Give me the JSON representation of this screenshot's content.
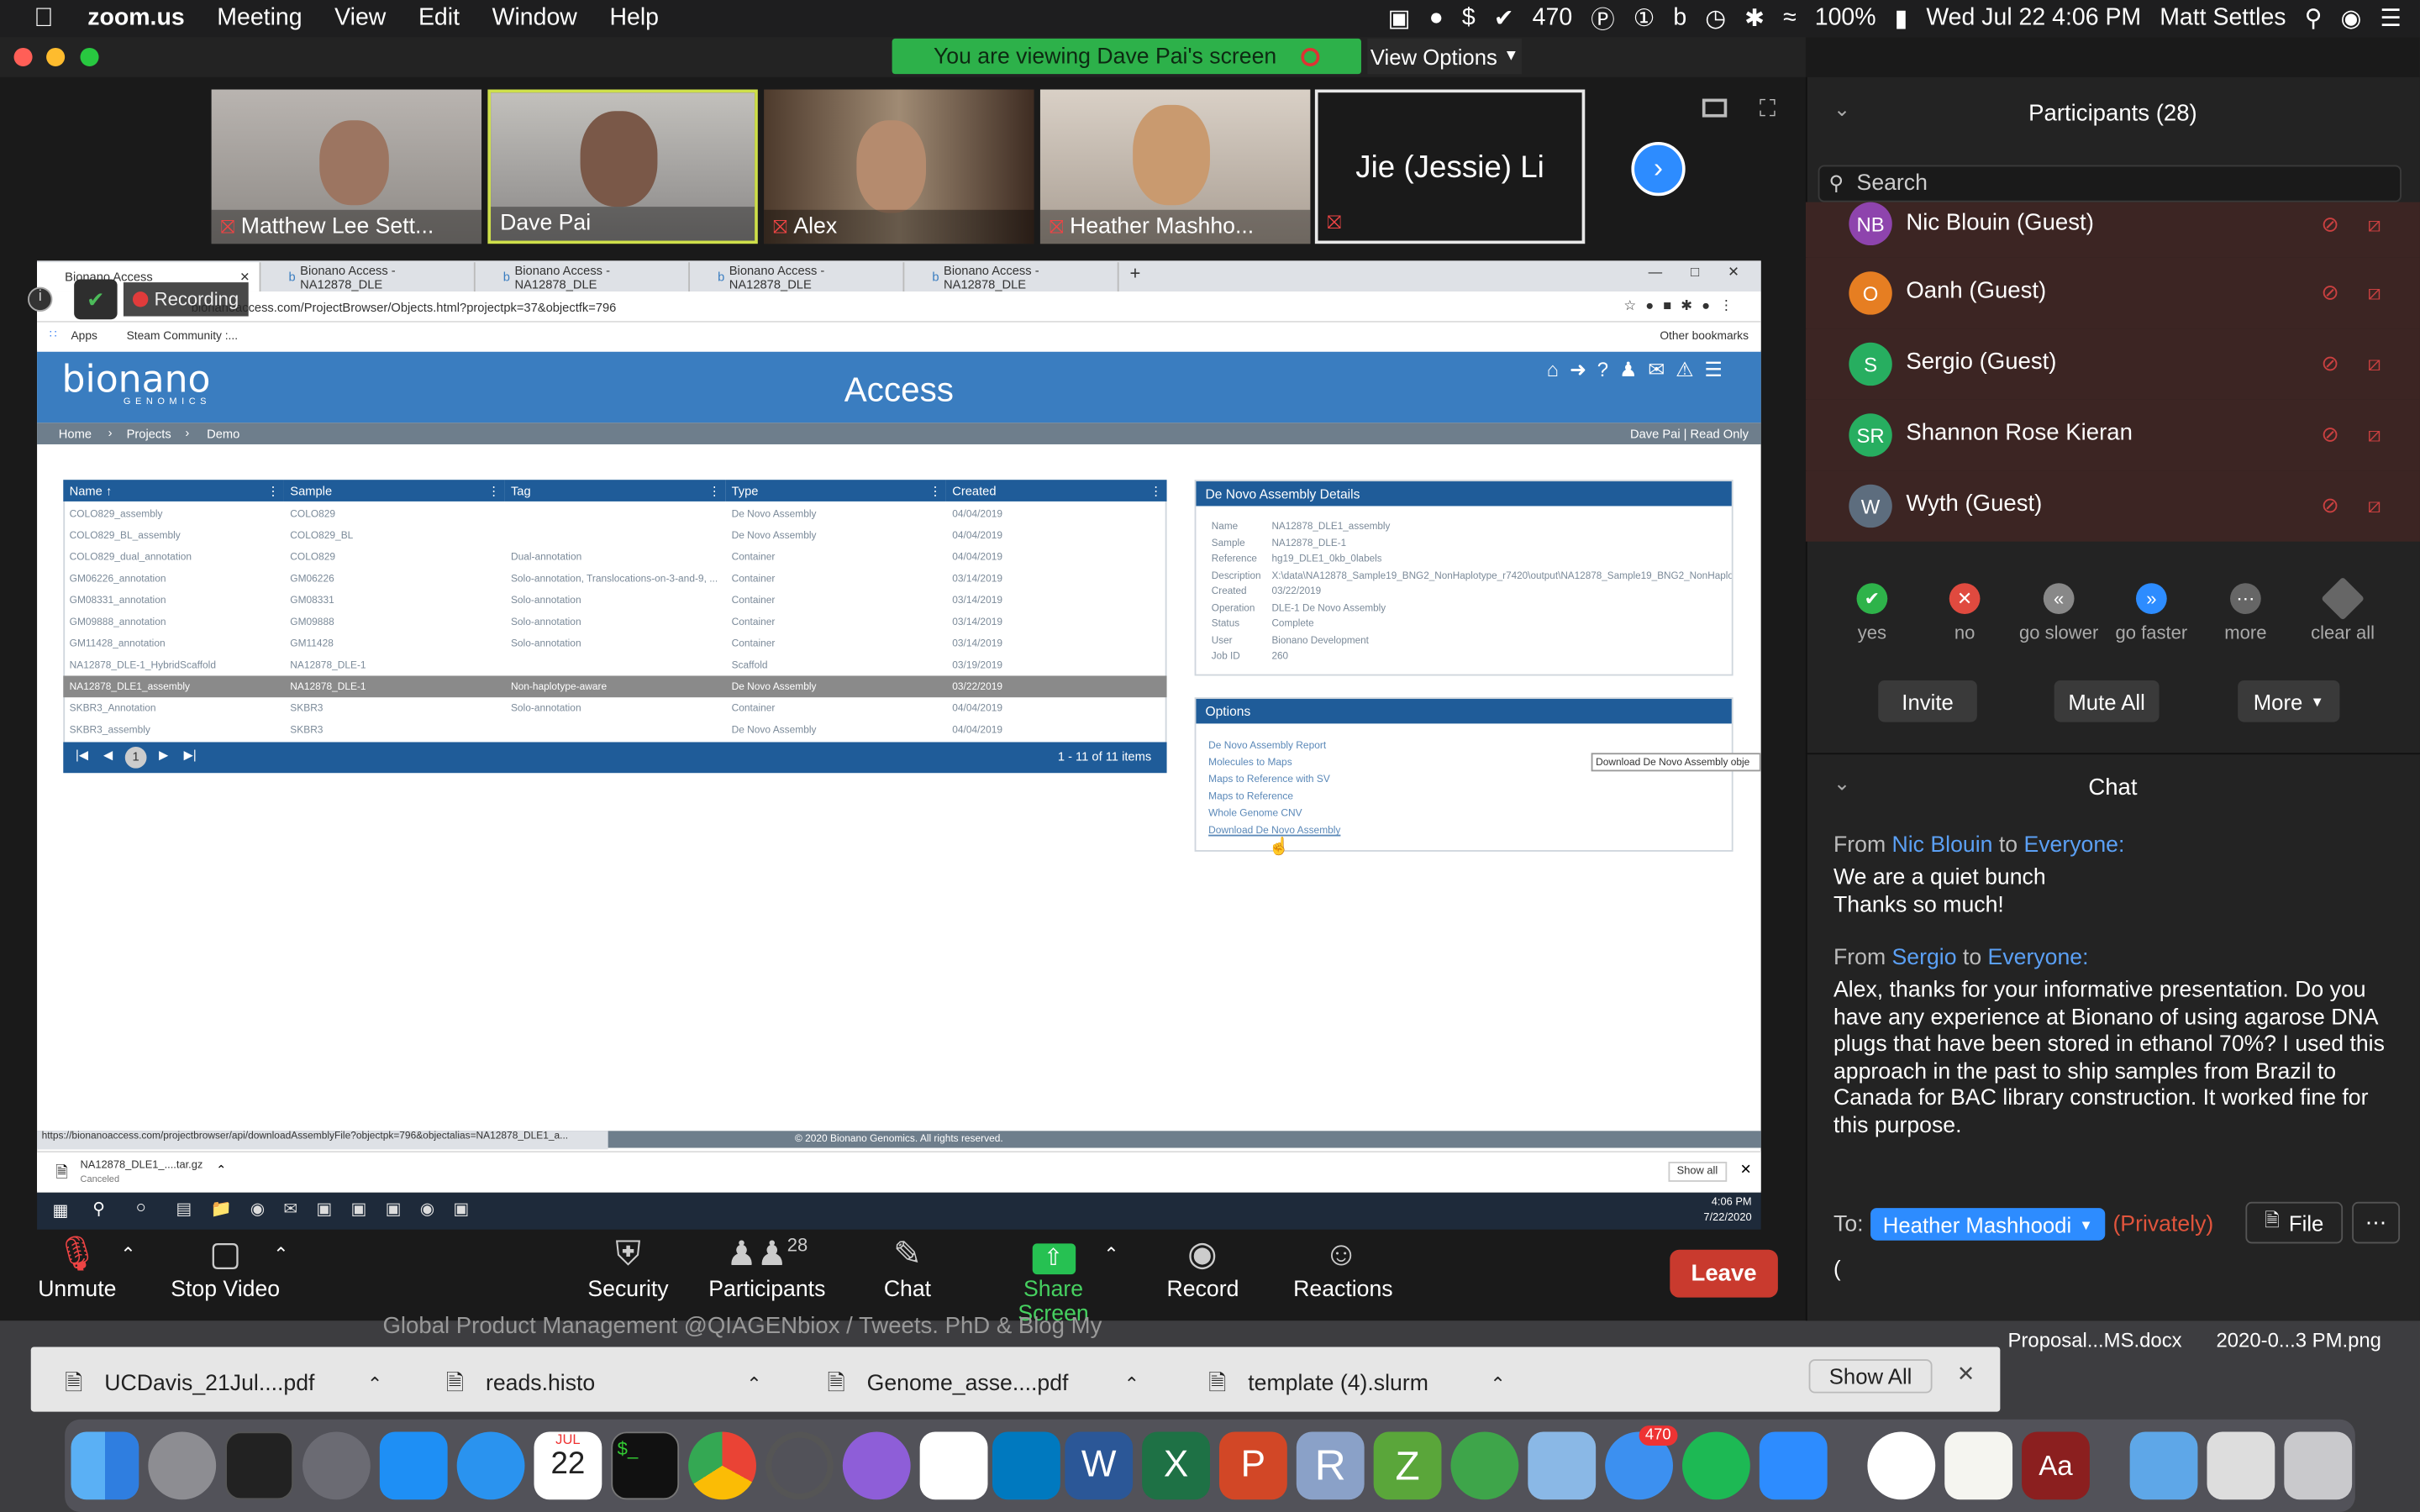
{
  "menubar": {
    "app": "zoom.us",
    "items": [
      "Meeting",
      "View",
      "Edit",
      "Window",
      "Help"
    ],
    "status": {
      "count": "470",
      "battery": "100%",
      "datetime": "Wed Jul 22  4:06 PM",
      "user": "Matt Settles"
    }
  },
  "banner": {
    "viewing": "You are viewing Dave Pai's screen",
    "view_options": "View Options"
  },
  "video_tiles": [
    {
      "name": "Matthew Lee Sett..."
    },
    {
      "name": "Dave Pai"
    },
    {
      "name": "Alex"
    },
    {
      "name": "Heather Mashho..."
    },
    {
      "name": "Jie (Jessie) Li"
    }
  ],
  "browser": {
    "tabs": [
      "Bionano Access",
      "Bionano Access - NA12878_DLE",
      "Bionano Access - NA12878_DLE",
      "Bionano Access - NA12878_DLE",
      "Bionano Access - NA12878_DLE"
    ],
    "recording": "Recording",
    "url": "bionanoaccess.com/ProjectBrowser/Objects.html?projectpk=37&objectfk=796",
    "bookmarks": [
      "Apps",
      "Steam Community :...",
      "Other bookmarks"
    ],
    "logo": "bionano",
    "logo_sub": "GENOMICS",
    "header_title": "Access",
    "breadcrumb": [
      "Home",
      "Projects",
      "Demo"
    ],
    "user_info": "Dave Pai | Read Only",
    "grid": {
      "columns": [
        "Name ↑",
        "Sample",
        "Tag",
        "Type",
        "Created"
      ],
      "rows": [
        [
          "COLO829_assembly",
          "COLO829",
          "",
          "De Novo Assembly",
          "04/04/2019"
        ],
        [
          "COLO829_BL_assembly",
          "COLO829_BL",
          "",
          "De Novo Assembly",
          "04/04/2019"
        ],
        [
          "COLO829_dual_annotation",
          "COLO829",
          "Dual-annotation",
          "Container",
          "04/04/2019"
        ],
        [
          "GM06226_annotation",
          "GM06226",
          "Solo-annotation, Translocations-on-3-and-9, ...",
          "Container",
          "03/14/2019"
        ],
        [
          "GM08331_annotation",
          "GM08331",
          "Solo-annotation",
          "Container",
          "03/14/2019"
        ],
        [
          "GM09888_annotation",
          "GM09888",
          "Solo-annotation",
          "Container",
          "03/14/2019"
        ],
        [
          "GM11428_annotation",
          "GM11428",
          "Solo-annotation",
          "Container",
          "03/14/2019"
        ],
        [
          "NA12878_DLE-1_HybridScaffold",
          "NA12878_DLE-1",
          "",
          "Scaffold",
          "03/19/2019"
        ],
        [
          "NA12878_DLE1_assembly",
          "NA12878_DLE-1",
          "Non-haplotype-aware",
          "De Novo Assembly",
          "03/22/2019"
        ],
        [
          "SKBR3_Annotation",
          "SKBR3",
          "Solo-annotation",
          "Container",
          "04/04/2019"
        ],
        [
          "SKBR3_assembly",
          "SKBR3",
          "",
          "De Novo Assembly",
          "04/04/2019"
        ]
      ],
      "page": "1",
      "items_text": "1 - 11 of 11 items"
    },
    "details": {
      "title": "De Novo Assembly Details",
      "fields": [
        [
          "Name",
          "NA12878_DLE1_assembly"
        ],
        [
          "Sample",
          "NA12878_DLE-1"
        ],
        [
          "Reference",
          "hg19_DLE1_0kb_0labels"
        ],
        [
          "Description",
          "X:\\data\\NA12878_Sample19_BNG2_NonHaplotype_r7420\\output\\NA12878_Sample19_BNG2_NonHaplo"
        ],
        [
          "Created",
          "03/22/2019"
        ],
        [
          "Operation",
          "DLE-1 De Novo Assembly"
        ],
        [
          "Status",
          "Complete"
        ],
        [
          "User",
          "Bionano Development"
        ],
        [
          "Job ID",
          "260"
        ]
      ]
    },
    "options": {
      "title": "Options",
      "items": [
        "De Novo Assembly Report",
        "Molecules to Maps",
        "Maps to Reference with SV",
        "Maps to Reference",
        "Whole Genome CNV",
        "Download De Novo Assembly"
      ],
      "tooltip": "Download De Novo Assembly obje"
    },
    "footer": "© 2020 Bionano Genomics. All rights reserved.",
    "status_url": "https://bionanoaccess.com/projectbrowser/api/downloadAssemblyFile?objectpk=796&objectalias=NA12878_DLE1_a...",
    "download": {
      "file": "NA12878_DLE1_....tar.gz",
      "state": "Canceled",
      "show_all": "Show all"
    },
    "win_clock": {
      "time": "4:06 PM",
      "date": "7/22/2020"
    }
  },
  "toolbar": {
    "unmute": "Unmute",
    "stop_video": "Stop Video",
    "security": "Security",
    "participants": "Participants",
    "participant_count": "28",
    "chat": "Chat",
    "share": "Share Screen",
    "record": "Record",
    "reactions": "Reactions",
    "leave": "Leave"
  },
  "participants_panel": {
    "title": "Participants (28)",
    "search_placeholder": "Search",
    "list": [
      {
        "initials": "NB",
        "name": "Nic Blouin (Guest)",
        "color": "#8e44ad"
      },
      {
        "initials": "O",
        "name": "Oanh (Guest)",
        "color": "#e67e22"
      },
      {
        "initials": "S",
        "name": "Sergio (Guest)",
        "color": "#27ae60"
      },
      {
        "initials": "SR",
        "name": "Shannon Rose Kieran",
        "color": "#27ae60"
      },
      {
        "initials": "W",
        "name": "Wyth (Guest)",
        "color": "#5d6d7e"
      }
    ],
    "feedback": [
      "yes",
      "no",
      "go slower",
      "go faster",
      "more",
      "clear all"
    ],
    "invite": "Invite",
    "mute_all": "Mute All",
    "more": "More"
  },
  "chat_panel": {
    "title": "Chat",
    "messages": [
      {
        "from": "Nic Blouin",
        "to": "Everyone:",
        "lines": [
          "We are a quiet bunch",
          "Thanks so much!"
        ]
      },
      {
        "from": "Sergio",
        "to": "Everyone:",
        "text": "Alex, thanks for your informative presentation. Do you have any experience at Bionano of using agarose DNA plugs that have been stored in ethanol 70%? I used this approach in the past to ship samples from Brazil to Canada for BAC library construction. It worked fine for this purpose."
      }
    ],
    "to_label": "To:",
    "recipient": "Heather Mashhoodi",
    "privately": "(Privately)",
    "file": "File",
    "input": "("
  },
  "behind": {
    "tweet_text": "Global Product Management @QIAGENbiox  / Tweets. PhD & Blog My",
    "desktop_files": [
      "Proposal...MS.docx",
      "2020-0...3 PM.png"
    ]
  },
  "mac_downloads": {
    "items": [
      "UCDavis_21Jul....pdf",
      "reads.histo",
      "Genome_asse....pdf",
      "template (4).slurm"
    ],
    "show_all": "Show All"
  },
  "dock": {
    "calendar_month": "JUL",
    "calendar_day": "22",
    "badge": "470",
    "r_label": "R"
  }
}
